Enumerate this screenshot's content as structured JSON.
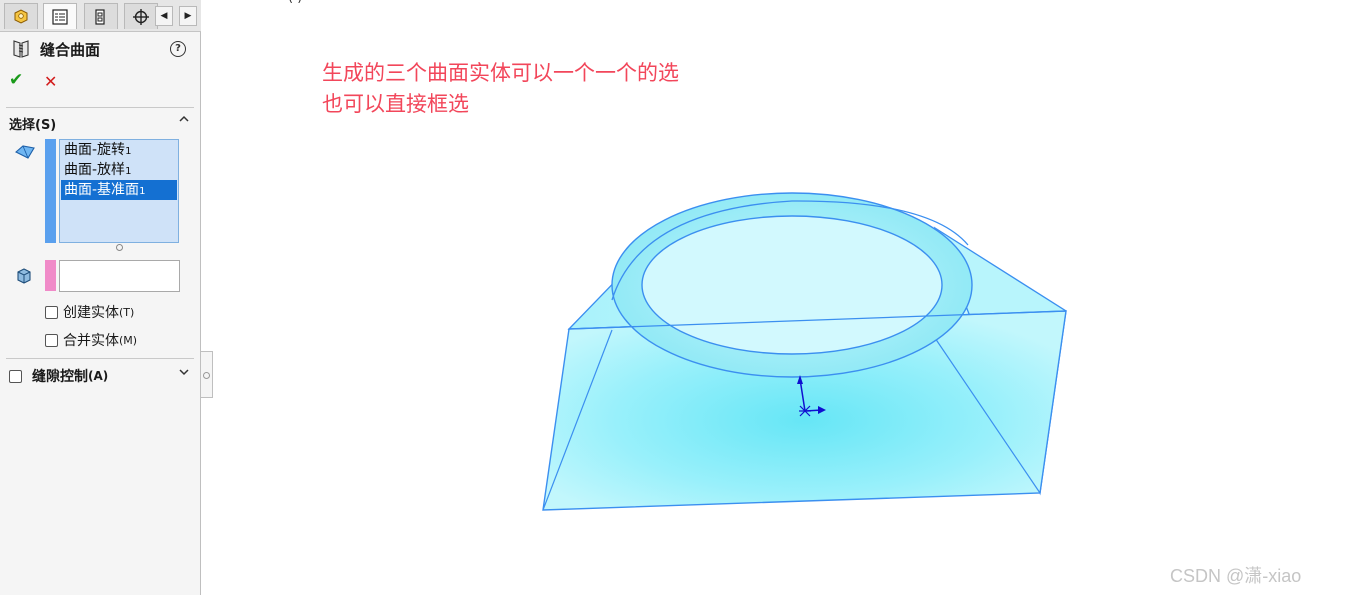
{
  "top_fragment": "(  )",
  "panel": {
    "feature_title": "缝合曲面",
    "help_symbol": "?",
    "ok_symbol": "✔",
    "cancel_symbol": "✕",
    "selection_section": {
      "label": "选择(S)",
      "items": [
        {
          "label": "曲面-旋转",
          "suffix": "1"
        },
        {
          "label": "曲面-放样",
          "suffix": "1"
        },
        {
          "label": "曲面-基准面",
          "suffix": "1",
          "selected": true
        }
      ],
      "body_field_value": ""
    },
    "options": [
      {
        "label": "创建实体",
        "shortcut": "(T)",
        "checked": false
      },
      {
        "label": "合并实体",
        "shortcut": "(M)",
        "checked": false
      }
    ],
    "gap_control": {
      "label": "缝隙控制",
      "shortcut": "(A)",
      "checked": false
    }
  },
  "annotation": {
    "line1": "生成的三个曲面实体可以一个一个的选",
    "line2": "也可以直接框选",
    "color": "#f2465a"
  },
  "watermark": "CSDN @潇-xiao",
  "colors": {
    "surface_fill": "#8aeaf8",
    "surface_edge": "#3b8ff0",
    "triad": "#1010d0"
  },
  "icons": [
    "part-icon",
    "feature-manager-icon",
    "configuration-manager-icon",
    "target-icon",
    "knit-surface-icon",
    "help-icon",
    "ok-icon",
    "cancel-icon",
    "surface-select-icon",
    "body-select-icon",
    "chevron-up-icon",
    "chevron-down-icon"
  ]
}
